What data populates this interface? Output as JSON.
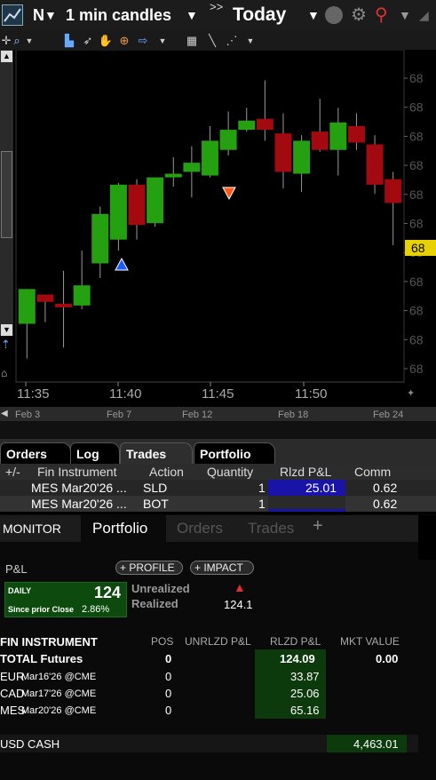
{
  "toolbar": {
    "symbol": "N",
    "interval": "1 min candles",
    "nav_marker": ">>",
    "range": "Today"
  },
  "chart_data": {
    "type": "candlestick",
    "x_ticks": [
      "11:35",
      "11:40",
      "11:45",
      "11:50"
    ],
    "y_ticks": [
      "68",
      "68",
      "68",
      "68",
      "68",
      "68",
      "68",
      "68",
      "68",
      "68",
      "68"
    ],
    "last_price_label": "68",
    "candles": [
      {
        "o": 1,
        "h": 2.4,
        "l": -0.9,
        "c": 2.9
      },
      {
        "o": 2.6,
        "h": 2.6,
        "l": 1.1,
        "c": 2.2
      },
      {
        "o": 2.1,
        "h": 3.9,
        "l": -0.3,
        "c": 1.9
      },
      {
        "o": 2.0,
        "h": 5.0,
        "l": 1.8,
        "c": 3.1
      },
      {
        "o": 4.3,
        "h": 7.4,
        "l": 3.5,
        "c": 7.0
      },
      {
        "o": 5.6,
        "h": 8.7,
        "l": 5.0,
        "c": 8.6
      },
      {
        "o": 8.6,
        "h": 8.9,
        "l": 5.6,
        "c": 6.4
      },
      {
        "o": 6.5,
        "h": 8.9,
        "l": 6.3,
        "c": 9.0
      },
      {
        "o": 9.0,
        "h": 10.1,
        "l": 8.5,
        "c": 9.2
      },
      {
        "o": 9.3,
        "h": 10.7,
        "l": 7.9,
        "c": 9.8
      },
      {
        "o": 9.1,
        "h": 11.8,
        "l": 9.0,
        "c": 11.0
      },
      {
        "o": 10.5,
        "h": 12.6,
        "l": 10.2,
        "c": 11.6
      },
      {
        "o": 11.6,
        "h": 12.8,
        "l": 11.5,
        "c": 12.1
      },
      {
        "o": 12.2,
        "h": 14.3,
        "l": 11.0,
        "c": 11.6
      },
      {
        "o": 11.4,
        "h": 12.5,
        "l": 8.4,
        "c": 9.3
      },
      {
        "o": 9.2,
        "h": 11.3,
        "l": 8.2,
        "c": 11.0
      },
      {
        "o": 11.5,
        "h": 13.3,
        "l": 10.4,
        "c": 10.5
      },
      {
        "o": 10.5,
        "h": 12.8,
        "l": 9.1,
        "c": 12.0
      },
      {
        "o": 11.8,
        "h": 12.5,
        "l": 10.5,
        "c": 10.9
      },
      {
        "o": 10.8,
        "h": 11.3,
        "l": 8.1,
        "c": 8.6
      },
      {
        "o": 8.9,
        "h": 9.3,
        "l": 5.3,
        "c": 7.6
      }
    ]
  },
  "date_axis": [
    "Feb 3",
    "Feb 7",
    "Feb 12",
    "Feb 18",
    "Feb 24"
  ],
  "trades_panel": {
    "tabs": [
      "Orders",
      "Log",
      "Trades",
      "Portfolio"
    ],
    "columns": [
      "+/-",
      "Fin Instrument",
      "Action",
      "Quantity",
      "Rlzd P&L",
      "Comm"
    ],
    "rows": [
      {
        "instrument": "MES Mar20'26 ...",
        "action": "SLD",
        "qty": "1",
        "pnl": "25.01",
        "comm": "0.62"
      },
      {
        "instrument": "MES Mar20'26 ...",
        "action": "BOT",
        "qty": "1",
        "pnl": "",
        "comm": "0.62"
      }
    ]
  },
  "monitor": {
    "title": "MONITOR",
    "tabs": [
      "Portfolio",
      "Orders",
      "Trades"
    ],
    "add": "+",
    "pnl_label": "P&L",
    "profile_btn": "+ PROFILE",
    "impact_btn": "+ IMPACT",
    "daily_label": "DAILY",
    "daily_value": "124",
    "since_label": "Since prior Close",
    "since_value": "2.86%",
    "unrealized_label": "Unrealized",
    "realized_label": "Realized",
    "realized_value": "124.1",
    "columns": [
      "FIN INSTRUMENT",
      "POS",
      "UNRLZD P&L",
      "RLZD P&L",
      "MKT VALUE"
    ],
    "total": {
      "name": "TOTAL Futures",
      "pos": "0",
      "rlzd": "124.09",
      "mkt": "0.00"
    },
    "rows": [
      {
        "sym": "EUR",
        "exp": "Mar16'26 @CME",
        "pos": "0",
        "rlzd": "33.87"
      },
      {
        "sym": "CAD",
        "exp": "Mar17'26 @CME",
        "pos": "0",
        "rlzd": "25.06"
      },
      {
        "sym": "MES",
        "exp": "Mar20'26 @CME",
        "pos": "0",
        "rlzd": "65.16"
      }
    ],
    "cash_label": "USD CASH",
    "cash_value": "4,463.01"
  },
  "colors": {
    "up": "#24a011",
    "down": "#a20a10",
    "accent": "#e8d100"
  }
}
